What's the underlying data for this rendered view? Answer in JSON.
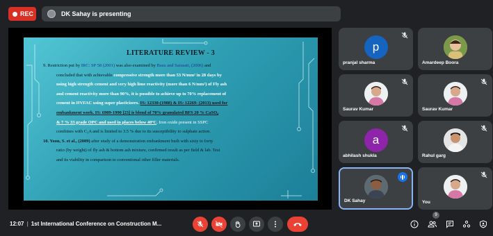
{
  "recording": {
    "label": "REC"
  },
  "presenter_banner": {
    "text": "DK Sahay is presenting"
  },
  "slide": {
    "title": "LITERATURE REVIEW - 3",
    "lines": [
      [
        "9. Restriction put by ",
        "IRC: SP 58 (2001)",
        " was also examined by ",
        "Basu and Sarasati, (2006)",
        " and"
      ],
      [
        "concluded that with achievable ",
        "compressive strength more than 53 N/mm² in 28 days by"
      ],
      [
        "using high strength cement and very high lime reactivity (more than 6 N/mm²) of Fly ash"
      ],
      [
        "and cement reactivity more than 90%, it is possible to achieve up to 70% replacement of"
      ],
      [
        "cement in HVFAC using super plasticizers. ",
        "IS: 12330-(1988) & IS: 12269- (2013) used for"
      ],
      [
        "embankment work. IS: 6909-1990 [23] is  blend of 70% granulated BFS  20 % CaSO₄"
      ],
      [
        "& 7 % 33 grade  OPC and  used in places below 40ºC",
        ". Iron oxide present in SSPC"
      ],
      [
        "combines with C₃A and is limited to 3.5 % due to its susceptibility to sulphate action."
      ],
      [
        "10. Yoon, S. et al., (2009)",
        "  after study of a demonstration embankment built with sixty to forty"
      ],
      [
        "ratio (by weight) of fly ash &  bottom ash mixture, confirmed result as per field & lab. Test"
      ],
      [
        "and its viability in comparison to conventional other filler materials."
      ]
    ]
  },
  "participants": [
    {
      "name": "pranjal sharma",
      "initial": "p",
      "color": "#1565c0",
      "muted": true
    },
    {
      "name": "Amardeep Boora",
      "initial": "",
      "color": "#c9b98a",
      "muted": false
    },
    {
      "name": "Saurav Kumar",
      "initial": "",
      "color": "#f0c9c2",
      "muted": true
    },
    {
      "name": "Saurav Kumar",
      "initial": "",
      "color": "#f0c9c2",
      "muted": true
    },
    {
      "name": "abhilash shukla",
      "initial": "a",
      "color": "#8e24aa",
      "muted": true
    },
    {
      "name": "Rahul garg",
      "initial": "",
      "color": "#d8d8d8",
      "muted": true
    },
    {
      "name": "DK Sahay",
      "initial": "",
      "color": "#6d7a86",
      "muted": false,
      "speaking": true
    },
    {
      "name": "You",
      "initial": "",
      "color": "#f0c9c2",
      "muted": true
    }
  ],
  "meeting": {
    "time": "12:07",
    "title": "1st International Conference on Construction M..."
  },
  "people_count": "9",
  "icons": {
    "mic": "mic-off-icon",
    "cam": "camera-off-icon",
    "hand": "raise-hand-icon",
    "present": "present-screen-icon",
    "more": "more-options-icon",
    "end": "end-call-icon",
    "info": "info-icon",
    "people": "people-icon",
    "chat": "chat-icon",
    "activities": "activities-icon",
    "host": "host-controls-icon"
  }
}
